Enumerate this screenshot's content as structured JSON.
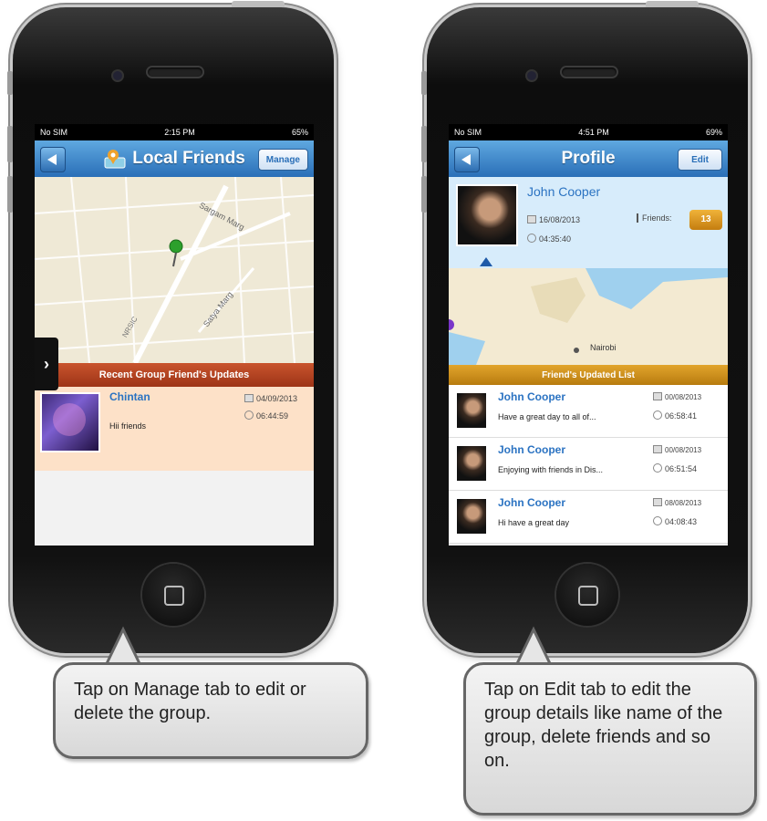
{
  "left_phone": {
    "status": {
      "carrier": "No SIM",
      "time": "2:15 PM",
      "battery": "65%"
    },
    "nav": {
      "title": "Local Friends",
      "manage_label": "Manage"
    },
    "map": {
      "road1": "Sargam Marg",
      "road2": "Satya Marg",
      "road3": "NRSIC"
    },
    "section_title": "Recent Group Friend's Updates",
    "update": {
      "name": "Chintan",
      "message": "Hii friends",
      "date": "04/09/2013",
      "time": "06:44:59"
    }
  },
  "right_phone": {
    "status": {
      "carrier": "No SIM",
      "time": "4:51 PM",
      "battery": "69%"
    },
    "nav": {
      "title": "Profile",
      "edit_label": "Edit"
    },
    "profile": {
      "name": "John Cooper",
      "date": "16/08/2013",
      "time": "04:35:40",
      "friends_label": "Friends:",
      "friends_count": "13"
    },
    "map": {
      "city": "Nairobi"
    },
    "section_title": "Friend's Updated List",
    "updates": [
      {
        "name": "John Cooper",
        "message": "Have a great day to all of...",
        "date": "00/08/2013",
        "time": "06:58:41"
      },
      {
        "name": "John Cooper",
        "message": "Enjoying with friends in Dis...",
        "date": "00/08/2013",
        "time": "06:51:54"
      },
      {
        "name": "John Cooper",
        "message": "Hi have a great day",
        "date": "08/08/2013",
        "time": "04:08:43"
      }
    ]
  },
  "callouts": {
    "left": "Tap on Manage tab to edit or delete the group.",
    "right": "Tap on Edit tab to edit the group details like name of the group, delete friends and so on."
  }
}
